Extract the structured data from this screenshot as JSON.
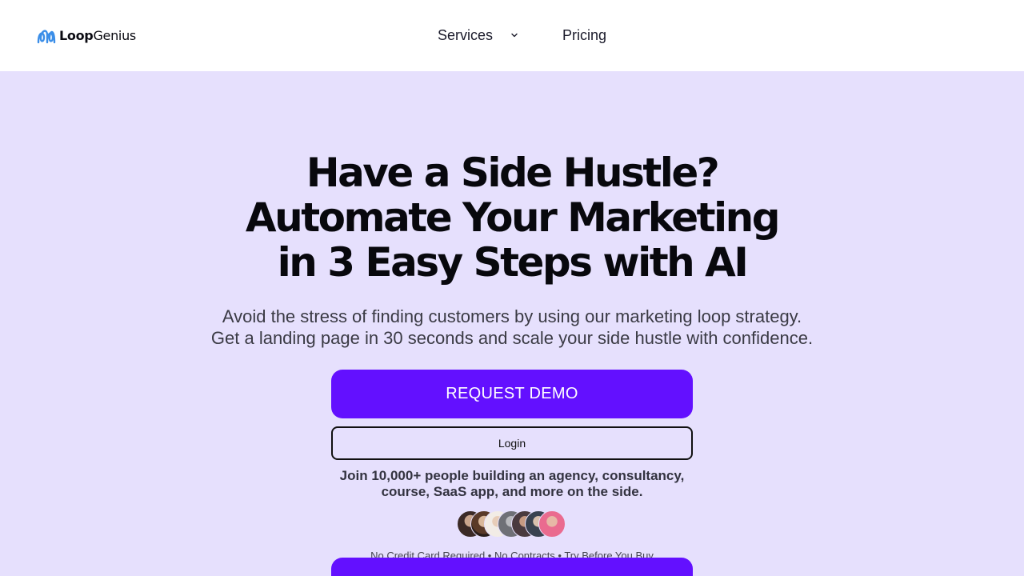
{
  "brand": {
    "name_bold": "Loop",
    "name_regular": "Genius"
  },
  "nav": {
    "services": "Services",
    "pricing": "Pricing"
  },
  "hero": {
    "title_lines": [
      "Have a Side Hustle?",
      "Automate Your Marketing",
      "in 3 Easy Steps with AI"
    ],
    "subtitle_lines": [
      "Avoid the stress of finding customers by using our marketing loop strategy.",
      "Get a landing page in 30 seconds and scale your side hustle with confidence."
    ]
  },
  "cta": {
    "demo_label": "REQUEST DEMO",
    "login_label": "Login"
  },
  "social_proof": {
    "lines": [
      "Join 10,000+ people building an agency, consultancy,",
      "course, SaaS app, and more on the side."
    ],
    "avatars": [
      "avatar-1",
      "avatar-2",
      "avatar-3",
      "avatar-4",
      "avatar-5",
      "avatar-6",
      "avatar-7"
    ]
  },
  "disclaimer": "No Credit Card Required • No Contracts • Try Before You Buy",
  "colors": {
    "accent": "#6310ff",
    "background": "#e6e0fd",
    "logo_blue": "#3b8ee8"
  }
}
